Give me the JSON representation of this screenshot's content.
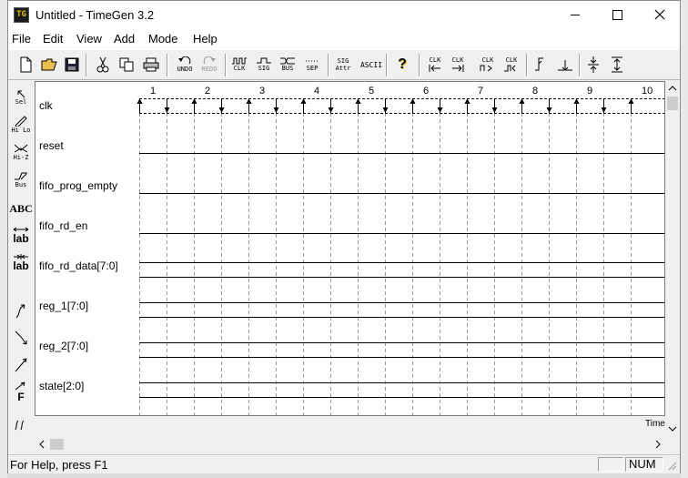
{
  "window": {
    "title": "Untitled - TimeGen 3.2",
    "app_icon_text": "TG"
  },
  "menu": [
    "File",
    "Edit",
    "View",
    "Add",
    "Mode",
    "Help"
  ],
  "menu_underlines": [
    "F",
    "E",
    "V",
    "A",
    "M",
    "H"
  ],
  "toolbar": {
    "undo": "UNDO",
    "redo": "REDO",
    "clk": "CLK",
    "sig": "SIG",
    "bus": "BUS",
    "sep": "SEP",
    "sig_attr_1": "SIG",
    "sig_attr_2": "Attr",
    "ascii": "ASCII",
    "help_icon": "?",
    "clk_a": "CLK",
    "clk_b": "CLK",
    "clk_c": "CLK",
    "clk_d": "CLK"
  },
  "left_tools": {
    "sel": "Sel",
    "hilo": "Hi Lo",
    "hiz": "Hi-Z",
    "bus": "Bus",
    "abc": "ABC",
    "lab1": "lab",
    "lab2": "lab",
    "f": "F"
  },
  "signals": [
    "clk",
    "reset",
    "fifo_prog_empty",
    "fifo_rd_en",
    "fifo_rd_data[7:0]",
    "reg_1[7:0]",
    "reg_2[7:0]",
    "state[2:0]"
  ],
  "clock_numbers": [
    "1",
    "2",
    "3",
    "4",
    "5",
    "6",
    "7",
    "8",
    "9",
    "10"
  ],
  "time_label": "Time",
  "status": {
    "help": "For Help, press F1",
    "num": "NUM"
  }
}
